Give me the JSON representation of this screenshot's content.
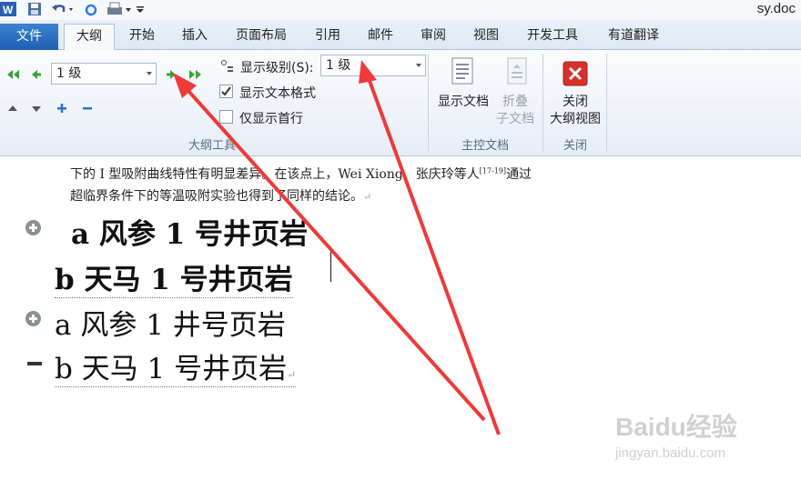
{
  "titlebar": {
    "doc_title": "sy.doc"
  },
  "tabs": {
    "file": "文件",
    "items": [
      "大纲",
      "开始",
      "插入",
      "页面布局",
      "引用",
      "邮件",
      "审阅",
      "视图",
      "开发工具",
      "有道翻译"
    ]
  },
  "outline_tools": {
    "level_value": "1 级",
    "show_level_label": "显示级别(S):",
    "show_level_value": "1 级",
    "show_text_format": "显示文本格式",
    "show_first_line": "仅显示首行",
    "group_label": "大纲工具"
  },
  "master_doc": {
    "show_doc": "显示文档",
    "collapse_line1": "折叠",
    "collapse_line2": "子文档",
    "group_label": "主控文档"
  },
  "close_group": {
    "close_line1": "关闭",
    "close_line2": "大纲视图",
    "group_label": "关闭"
  },
  "document": {
    "para_line1a": "下的 I 型吸附曲线特性有明显差异。在该点上，Wei Xiong、张庆玲等人",
    "para_line1_cite": "[17-19]",
    "para_line1b": "通过",
    "para_line2": "超临界条件下的等温吸附实验也得到了同样的结论。",
    "mark": "↵",
    "h1": "a  风参 1 号井页岩",
    "h2": "b  天马 1 号井页岩",
    "h3": "a 风参 1 井号页岩",
    "h4": "b 天马 1 号井页岩"
  },
  "watermark": {
    "brand": "Baidu经验",
    "url": "jingyan.baidu.com"
  },
  "colors": {
    "accent_blue": "#1f5fb2",
    "annotation_red": "#ee3a3a",
    "close_red": "#d9302a"
  }
}
